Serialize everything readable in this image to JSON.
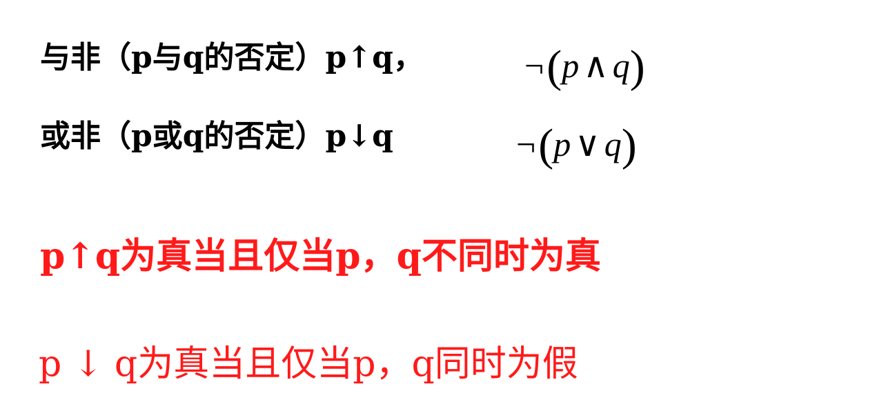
{
  "definitions": [
    {
      "text": "与非（p与q的否定）p↑q，"
    },
    {
      "text": "或非（p或q的否定）p↓q"
    }
  ],
  "formulas": [
    {
      "negation": "¬",
      "open": "(",
      "left": "p",
      "operator": "∧",
      "right": "q",
      "close": ")"
    },
    {
      "negation": "¬",
      "open": "(",
      "left": "p",
      "operator": "∨",
      "right": "q",
      "close": ")"
    }
  ],
  "notes": [
    {
      "text": "p↑q为真当且仅当p，q不同时为真",
      "color": "#ff1a1a"
    },
    {
      "text": "p ↓ q为真当且仅当p，q同时为假",
      "color": "#ff1a1a"
    }
  ]
}
